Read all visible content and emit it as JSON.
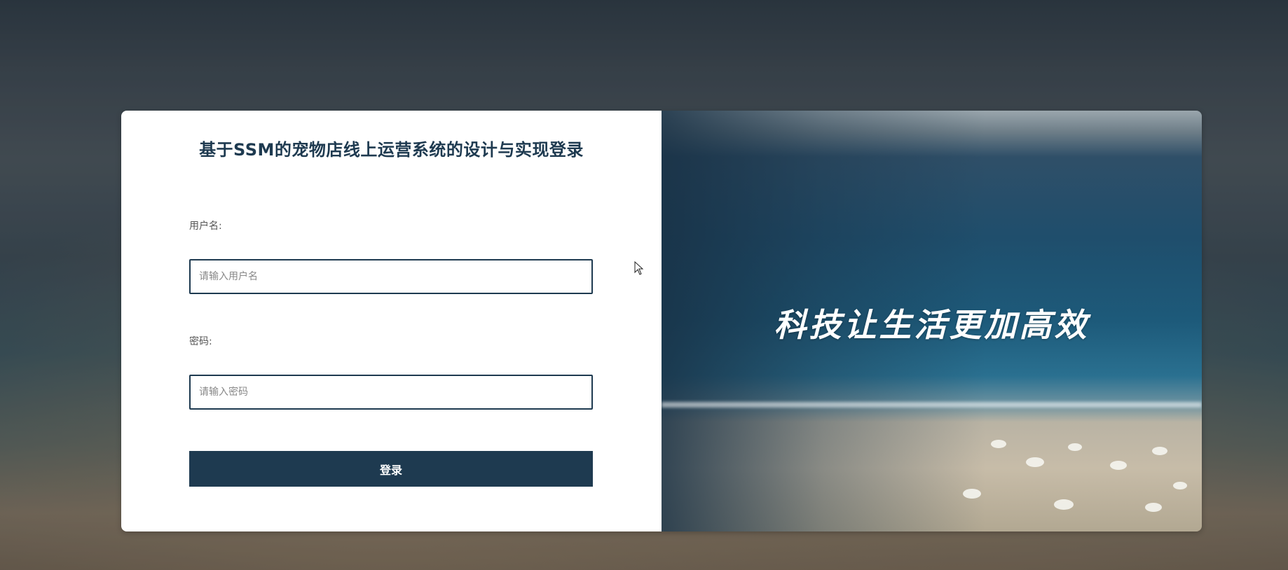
{
  "login": {
    "title": "基于SSM的宠物店线上运营系统的设计与实现登录",
    "username_label": "用户名:",
    "username_placeholder": "请输入用户名",
    "password_label": "密码:",
    "password_placeholder": "请输入密码",
    "submit_label": "登录"
  },
  "banner": {
    "slogan": "科技让生活更加高效"
  },
  "colors": {
    "primary": "#1e3a50",
    "panel_bg": "#ffffff",
    "label_text": "#555555"
  },
  "icons": {
    "cursor": "mouse-pointer-icon"
  }
}
